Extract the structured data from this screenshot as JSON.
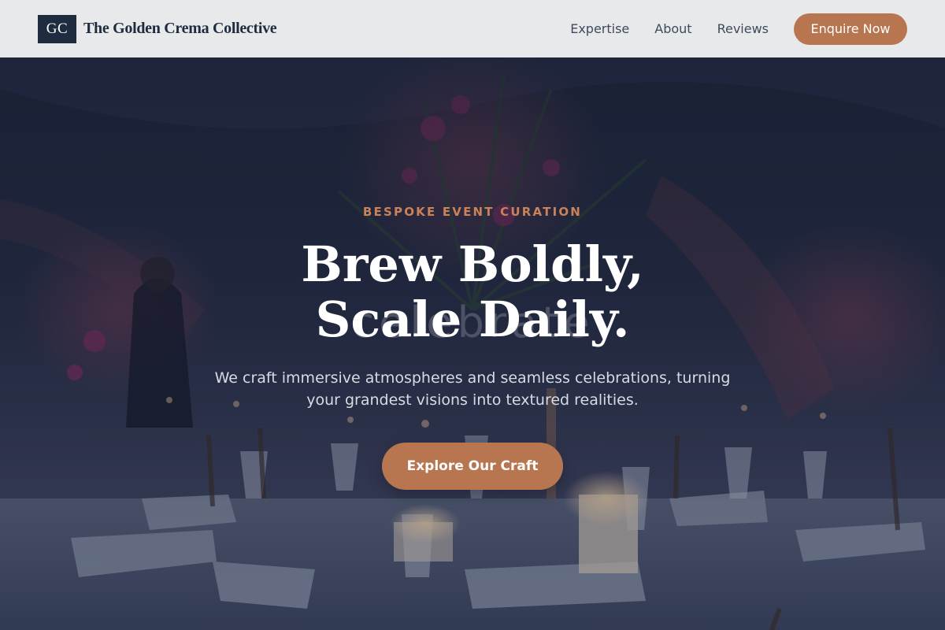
{
  "header": {
    "logo_initials": "GC",
    "brand_name": "The Golden Crema Collective",
    "nav": [
      {
        "label": "Expertise"
      },
      {
        "label": "About"
      },
      {
        "label": "Reviews"
      }
    ],
    "cta_label": "Enquire Now"
  },
  "hero": {
    "eyebrow": "BESPOKE EVENT CURATION",
    "ghost_text": "celebrate",
    "headline_line1": "Brew Boldly,",
    "headline_line2": "Scale Daily.",
    "subtext": "We craft immersive atmospheres and seamless celebrations, turning your grandest visions into textured realities.",
    "cta_label": "Explore Our Craft",
    "background_image": "dimly lit banquet table with glassware, napkins, candles and floral centerpiece"
  },
  "colors": {
    "accent": "#b87650",
    "eyebrow": "#c9825a",
    "header_bg": "#e8e9ea",
    "logo_bg": "#1f2b3e",
    "nav_text": "#3f4a5c",
    "hero_overlay": "#161a2c"
  }
}
